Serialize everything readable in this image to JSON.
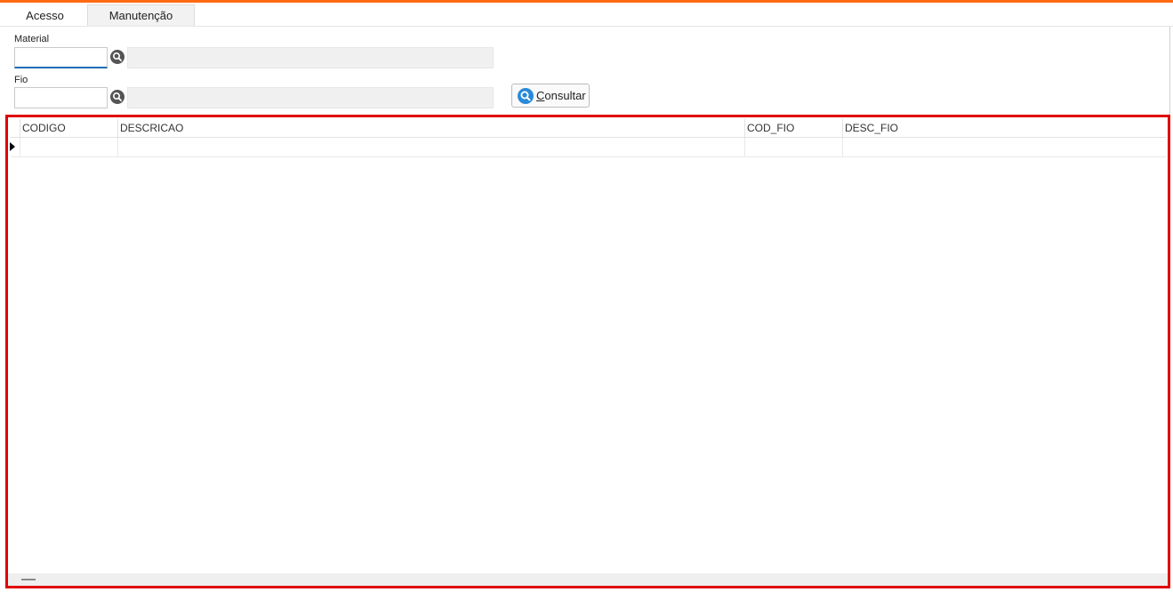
{
  "tabs": [
    {
      "label": "Acesso",
      "active": true
    },
    {
      "label": "Manutenção",
      "active": false
    }
  ],
  "filters": {
    "material": {
      "label": "Material",
      "value": "",
      "description": ""
    },
    "fio": {
      "label": "Fio",
      "value": "",
      "description": ""
    }
  },
  "buttons": {
    "consultar": {
      "first_letter": "C",
      "rest": "onsultar"
    }
  },
  "grid": {
    "columns": [
      "CODIGO",
      "DESCRICAO",
      "COD_FIO",
      "DESC_FIO"
    ],
    "rows": [
      {
        "CODIGO": "",
        "DESCRICAO": "",
        "COD_FIO": "",
        "DESC_FIO": ""
      }
    ]
  },
  "colors": {
    "accent_top": "#ff6a13",
    "highlight_border": "#e00000",
    "focus": "#1f6fb5"
  },
  "icons": [
    "lookup-search-icon",
    "consultar-search-icon",
    "row-pointer-icon"
  ]
}
